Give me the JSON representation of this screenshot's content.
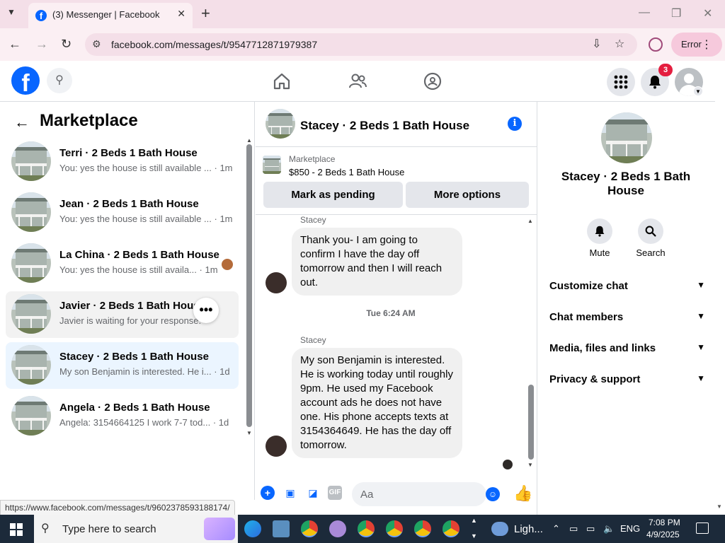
{
  "browser": {
    "tab_title": "(3) Messenger | Facebook",
    "url": "facebook.com/messages/t/9547712871979387",
    "error_label": "Error",
    "status_url": "https://www.facebook.com/messages/t/9602378593188174/"
  },
  "fb_nav": {
    "notification_count": "3"
  },
  "left": {
    "title": "Marketplace",
    "conversations": [
      {
        "name": "Terri · 2 Beds 1 Bath House",
        "snippet": "You: yes the house is still available ...",
        "time": "1m"
      },
      {
        "name": "Jean · 2 Beds 1 Bath House",
        "snippet": "You: yes the house is still available ...",
        "time": "1m"
      },
      {
        "name": "La China · 2 Beds 1 Bath House",
        "snippet": "You: yes the house is still availa...",
        "time": "1m"
      },
      {
        "name": "Javier · 2 Beds 1 Bath House",
        "snippet": "Javier is waiting for your response.",
        "time": ""
      },
      {
        "name": "Stacey · 2 Beds 1 Bath House",
        "snippet": "My son Benjamin is interested. He i...",
        "time": "1d"
      },
      {
        "name": "Angela · 2 Beds 1 Bath House",
        "snippet": "Angela: 3154664125 I work 7-7 tod...",
        "time": "1d"
      }
    ]
  },
  "chat": {
    "title": "Stacey · 2 Beds 1 Bath House",
    "listing_category": "Marketplace",
    "listing_price": "$850 - 2 Beds 1 Bath House",
    "mark_pending_label": "Mark as pending",
    "more_options_label": "More options",
    "messages": [
      {
        "sender": "Stacey",
        "text": "Thank you- I am going to confirm I have the day off tomorrow and then I will reach out."
      },
      {
        "sender": "Stacey",
        "text": "My son Benjamin is interested. He is working today until roughly 9pm. He used my Facebook account ads he does not have one. His  phone accepts texts at 3154364649. He has the day off tomorrow."
      }
    ],
    "timestamp": "Tue 6:24 AM",
    "composer_placeholder": "Aa"
  },
  "right": {
    "name": "Stacey · 2 Beds 1 Bath House",
    "mute_label": "Mute",
    "search_label": "Search",
    "sections": [
      "Customize chat",
      "Chat members",
      "Media, files and links",
      "Privacy & support"
    ]
  },
  "taskbar": {
    "search_placeholder": "Type here to search",
    "weather_text": "Ligh...",
    "language": "ENG",
    "time": "7:08 PM",
    "date": "4/9/2025"
  }
}
